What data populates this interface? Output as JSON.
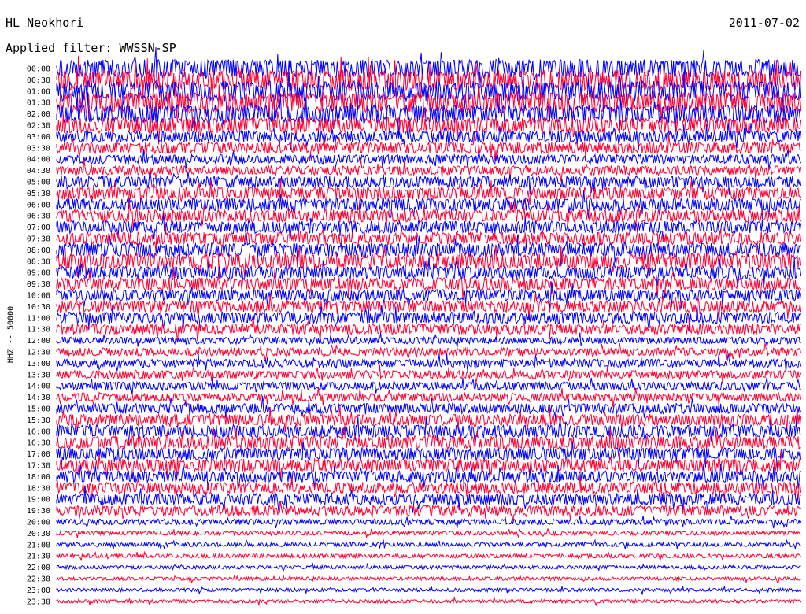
{
  "header": {
    "station": "HL Neokhori",
    "date": "2011-07-02",
    "filter": "Applied filter: WWSSN-SP"
  },
  "chart_data": {
    "type": "line",
    "title": "HL Neokhori",
    "ylabel": "HHZ -- 50000",
    "row_labels": [
      "00:00",
      "00:30",
      "01:00",
      "01:30",
      "02:00",
      "02:30",
      "03:00",
      "03:30",
      "04:00",
      "04:30",
      "05:00",
      "05:30",
      "06:00",
      "06:30",
      "07:00",
      "07:30",
      "08:00",
      "08:30",
      "09:00",
      "09:30",
      "10:00",
      "10:30",
      "11:00",
      "11:30",
      "12:00",
      "12:30",
      "13:00",
      "13:30",
      "14:00",
      "14:30",
      "15:00",
      "15:30",
      "16:00",
      "16:30",
      "17:00",
      "17:30",
      "18:00",
      "18:30",
      "19:00",
      "19:30",
      "20:00",
      "20:30",
      "21:00",
      "21:30",
      "22:00",
      "22:30",
      "23:00",
      "23:30"
    ],
    "trace_colors": [
      "#0000ff",
      "#ff0033"
    ],
    "noise_amplitude": [
      1.6,
      1.8,
      1.8,
      1.8,
      1.6,
      1.4,
      1.0,
      1.0,
      0.8,
      0.8,
      1.0,
      1.1,
      1.1,
      1.1,
      1.1,
      1.1,
      1.2,
      1.4,
      1.1,
      1.1,
      1.0,
      1.0,
      1.0,
      0.9,
      0.6,
      0.7,
      0.7,
      0.7,
      0.7,
      0.7,
      0.9,
      1.0,
      1.1,
      1.2,
      1.1,
      1.1,
      1.0,
      1.0,
      1.0,
      0.9,
      0.5,
      0.35,
      0.35,
      0.35,
      0.3,
      0.3,
      0.3,
      0.3
    ]
  }
}
